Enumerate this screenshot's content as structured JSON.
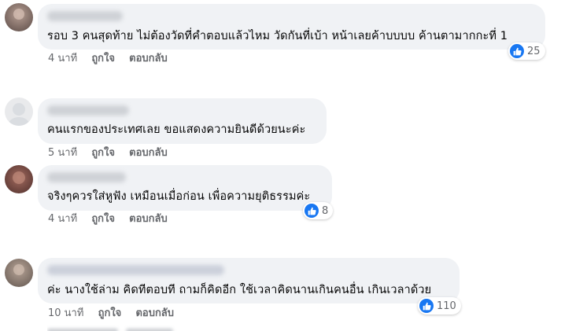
{
  "comments": [
    {
      "text": "รอบ 3 คนสุดท้าย ไม่ต้องวัดที่คำตอบแล้วไหม วัดกันที่เบ้า หน้าเลยค้าบบบบ ค้านตามากกะที่ 1",
      "time": "4 นาที",
      "like": "ถูกใจ",
      "reply": "ตอบกลับ",
      "reaction_count": "25"
    },
    {
      "text": "คนแรกของประเทศเลย ขอแสดงความยินดีด้วยนะค่ะ",
      "time": "5 นาที",
      "like": "ถูกใจ",
      "reply": "ตอบกลับ",
      "reaction_count": ""
    },
    {
      "text": "จริงๆควรใส่หูฟัง เหมือนเมื่อก่อน เพื่อความยุติธรรมค่ะ",
      "time": "4 นาที",
      "like": "ถูกใจ",
      "reply": "ตอบกลับ",
      "reaction_count": "8"
    },
    {
      "text": "ค่ะ นางใช้ล่าม คิดทีตอบที ถามก็คิดอีก ใช้เวลาคิดนานเกินคนอื่น เกินเวลาด้วย",
      "time": "10 นาที",
      "like": "ถูกใจ",
      "reply": "ตอบกลับ",
      "reaction_count": "110"
    }
  ],
  "colors": {
    "bubble": "#f0f2f5",
    "secondary_text": "#65676b",
    "like_blue": "#1877f2"
  },
  "icons": {
    "reaction": "like-thumbs-up-icon",
    "avatar": "blurred-profile-photo"
  }
}
